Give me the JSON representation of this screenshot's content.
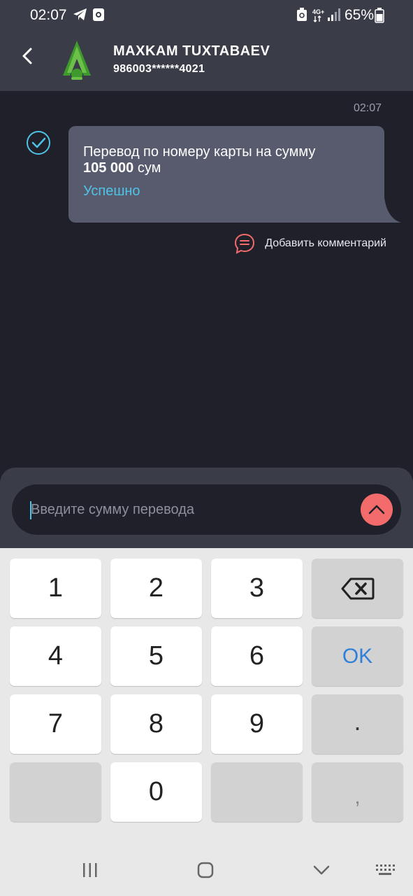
{
  "status_bar": {
    "time": "02:07",
    "network": "4G+",
    "battery": "65%"
  },
  "header": {
    "contact_name": "MAXKAM TUXTABAEV",
    "card_number": "986003******4021"
  },
  "chat": {
    "time": "02:07",
    "message_line1": "Перевод по номеру карты на сумму",
    "amount": "105 000",
    "currency": "сум",
    "status": "Успешно",
    "add_comment": "Добавить комментарий"
  },
  "input": {
    "placeholder": "Введите сумму перевода",
    "value": ""
  },
  "keyboard": {
    "keys": [
      "1",
      "2",
      "3",
      "4",
      "5",
      "6",
      "7",
      "8",
      "9",
      "0"
    ],
    "ok_label": "OK",
    "dot_label": ".",
    "comma_label": ","
  },
  "colors": {
    "background": "#1f2029",
    "header": "#3a3c48",
    "bubble": "#585b6e",
    "accent": "#4ec3e6",
    "send_button": "#f36b6b",
    "ok_key": "#2f80d9"
  }
}
